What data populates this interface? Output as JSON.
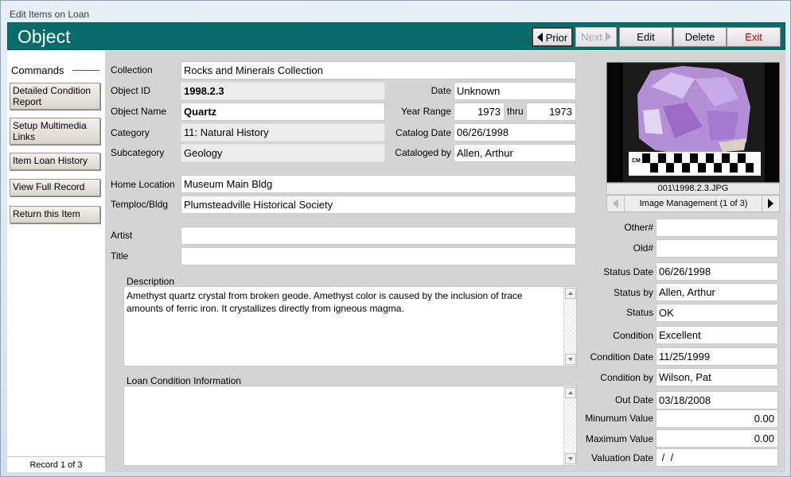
{
  "window": {
    "title": "Edit Items on Loan"
  },
  "header": {
    "title": "Object",
    "prior_label": "Prior",
    "next_label": "Next",
    "edit_label": "Edit",
    "delete_label": "Delete",
    "exit_label": "Exit"
  },
  "commands": {
    "heading": "Commands",
    "items": [
      "Detailed Condition Report",
      "Setup Multimedia Links",
      "Item Loan History",
      "View Full Record",
      "Return this Item"
    ],
    "record_counter": "Record 1 of 3"
  },
  "form": {
    "collection": {
      "label": "Collection",
      "value": "Rocks and Minerals Collection"
    },
    "object_id": {
      "label": "Object ID",
      "value": "1998.2.3"
    },
    "object_name": {
      "label": "Object Name",
      "value": "Quartz"
    },
    "category": {
      "label": "Category",
      "value": "11: Natural History"
    },
    "subcategory": {
      "label": "Subcategory",
      "value": "Geology"
    },
    "date": {
      "label": "Date",
      "value": "Unknown"
    },
    "year_range": {
      "label": "Year Range",
      "from": "1973",
      "thru_label": "thru",
      "to": "1973"
    },
    "catalog_date": {
      "label": "Catalog Date",
      "value": "06/26/1998"
    },
    "cataloged_by": {
      "label": "Cataloged by",
      "value": "Allen, Arthur"
    },
    "home_location": {
      "label": "Home Location",
      "value": "Museum Main Bldg"
    },
    "temploc": {
      "label": "Temploc/Bldg",
      "value": "Plumsteadville Historical Society"
    },
    "artist": {
      "label": "Artist",
      "value": ""
    },
    "title": {
      "label": "Title",
      "value": ""
    },
    "description": {
      "label": "Description",
      "value": "Amethyst quartz crystal from broken geode.  Amethyst color is caused by the inclusion of trace amounts of ferric iron.  It crystallizes directly from igneous magma."
    },
    "loan_condition": {
      "label": "Loan Condition Information",
      "value": ""
    }
  },
  "image": {
    "caption": "001\\1998.2.3.JPG",
    "management_label": "Image Management (1 of 3)",
    "scale_label": "CM"
  },
  "status": {
    "other_no": {
      "label": "Other#",
      "value": ""
    },
    "old_no": {
      "label": "Old#",
      "value": ""
    },
    "status_date": {
      "label": "Status Date",
      "value": "06/26/1998"
    },
    "status_by": {
      "label": "Status by",
      "value": "Allen, Arthur"
    },
    "status": {
      "label": "Status",
      "value": "OK"
    },
    "condition": {
      "label": "Condition",
      "value": "Excellent"
    },
    "condition_date": {
      "label": "Condition Date",
      "value": "11/25/1999"
    },
    "condition_by": {
      "label": "Condition by",
      "value": "Wilson, Pat"
    },
    "out_date": {
      "label": "Out Date",
      "value": "03/18/2008"
    },
    "min_value": {
      "label": "Minumum Value",
      "value": "0.00"
    },
    "max_value": {
      "label": "Maximum Value",
      "value": "0.00"
    },
    "valuation_date": {
      "label": "Valuation Date",
      "value": " /  /"
    }
  },
  "colors": {
    "header_bg": "#0a6b6b",
    "exit_text": "#d00000",
    "form_bg": "#d4d4d4"
  }
}
